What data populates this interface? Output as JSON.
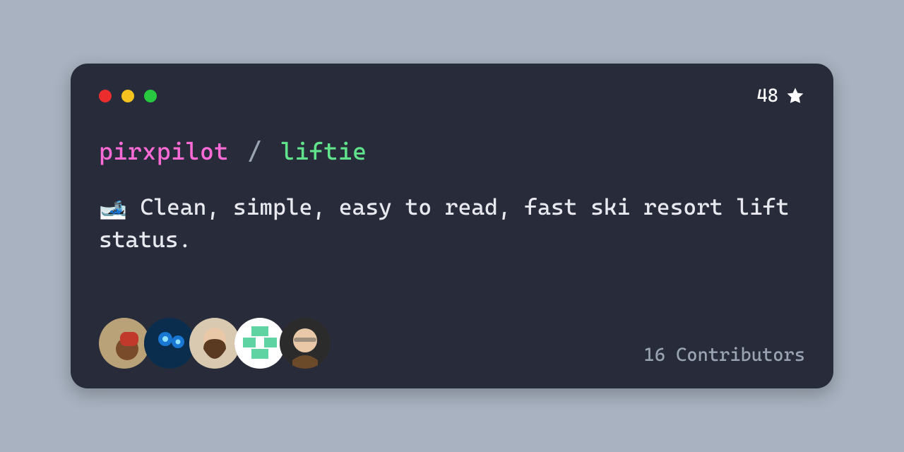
{
  "header": {
    "stars": "48"
  },
  "repo": {
    "owner": "pirxpilot",
    "separator": "/",
    "name": "liftie"
  },
  "description": "🎿 Clean, simple, easy to read, fast ski resort lift status.",
  "contributors": {
    "label": "16 Contributors"
  }
}
